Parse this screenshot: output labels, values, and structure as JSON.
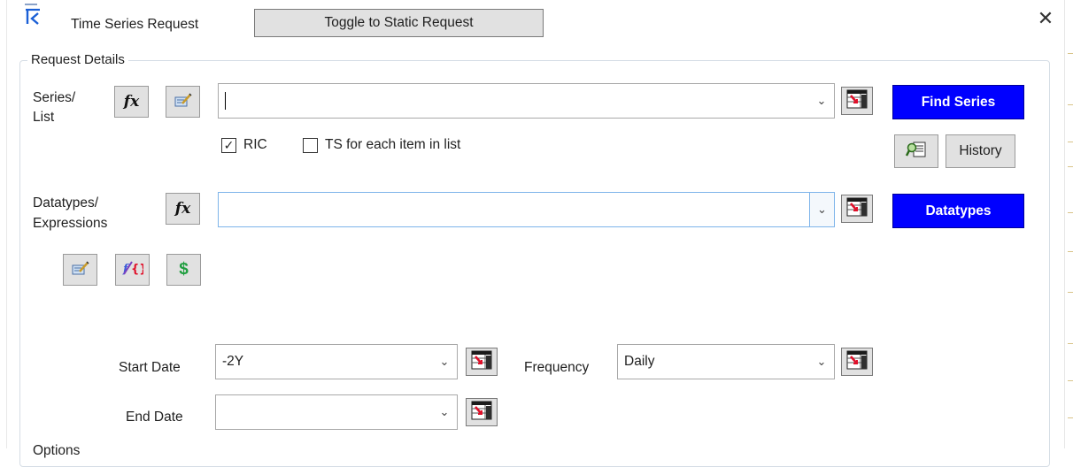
{
  "window": {
    "title": "Time Series Request",
    "toggle_label": "Toggle to Static Request",
    "close_glyph": "✕"
  },
  "request_details": {
    "legend": "Request Details",
    "series": {
      "label_line1": "Series/",
      "label_line2": "List",
      "fx_label": "fx",
      "value": "",
      "find_label": "Find Series",
      "ric_label": "RIC",
      "ric_checked": true,
      "ts_each_label": "TS for each item in list",
      "ts_each_checked": false,
      "history_label": "History"
    },
    "datatypes": {
      "label_line1": "Datatypes/",
      "label_line2": "Expressions",
      "fx_label": "fx",
      "value": "",
      "button_label": "Datatypes",
      "currency_glyph": "$"
    },
    "dates": {
      "start_label": "Start Date",
      "start_value": "-2Y",
      "end_label": "End Date",
      "end_value": "",
      "frequency_label": "Frequency",
      "frequency_value": "Daily"
    },
    "options_partial": "Options"
  },
  "colors": {
    "accent_blue": "#0000ff",
    "button_gray": "#e1e1e1",
    "focus_border": "#7eb4ea"
  },
  "icons": [
    "app-logo-icon",
    "fx-icon",
    "edit-list-icon",
    "picker-grid-icon",
    "search-list-icon",
    "expression-builder-icon",
    "currency-icon",
    "close-icon",
    "dropdown-arrow-icon",
    "checkmark-icon"
  ]
}
